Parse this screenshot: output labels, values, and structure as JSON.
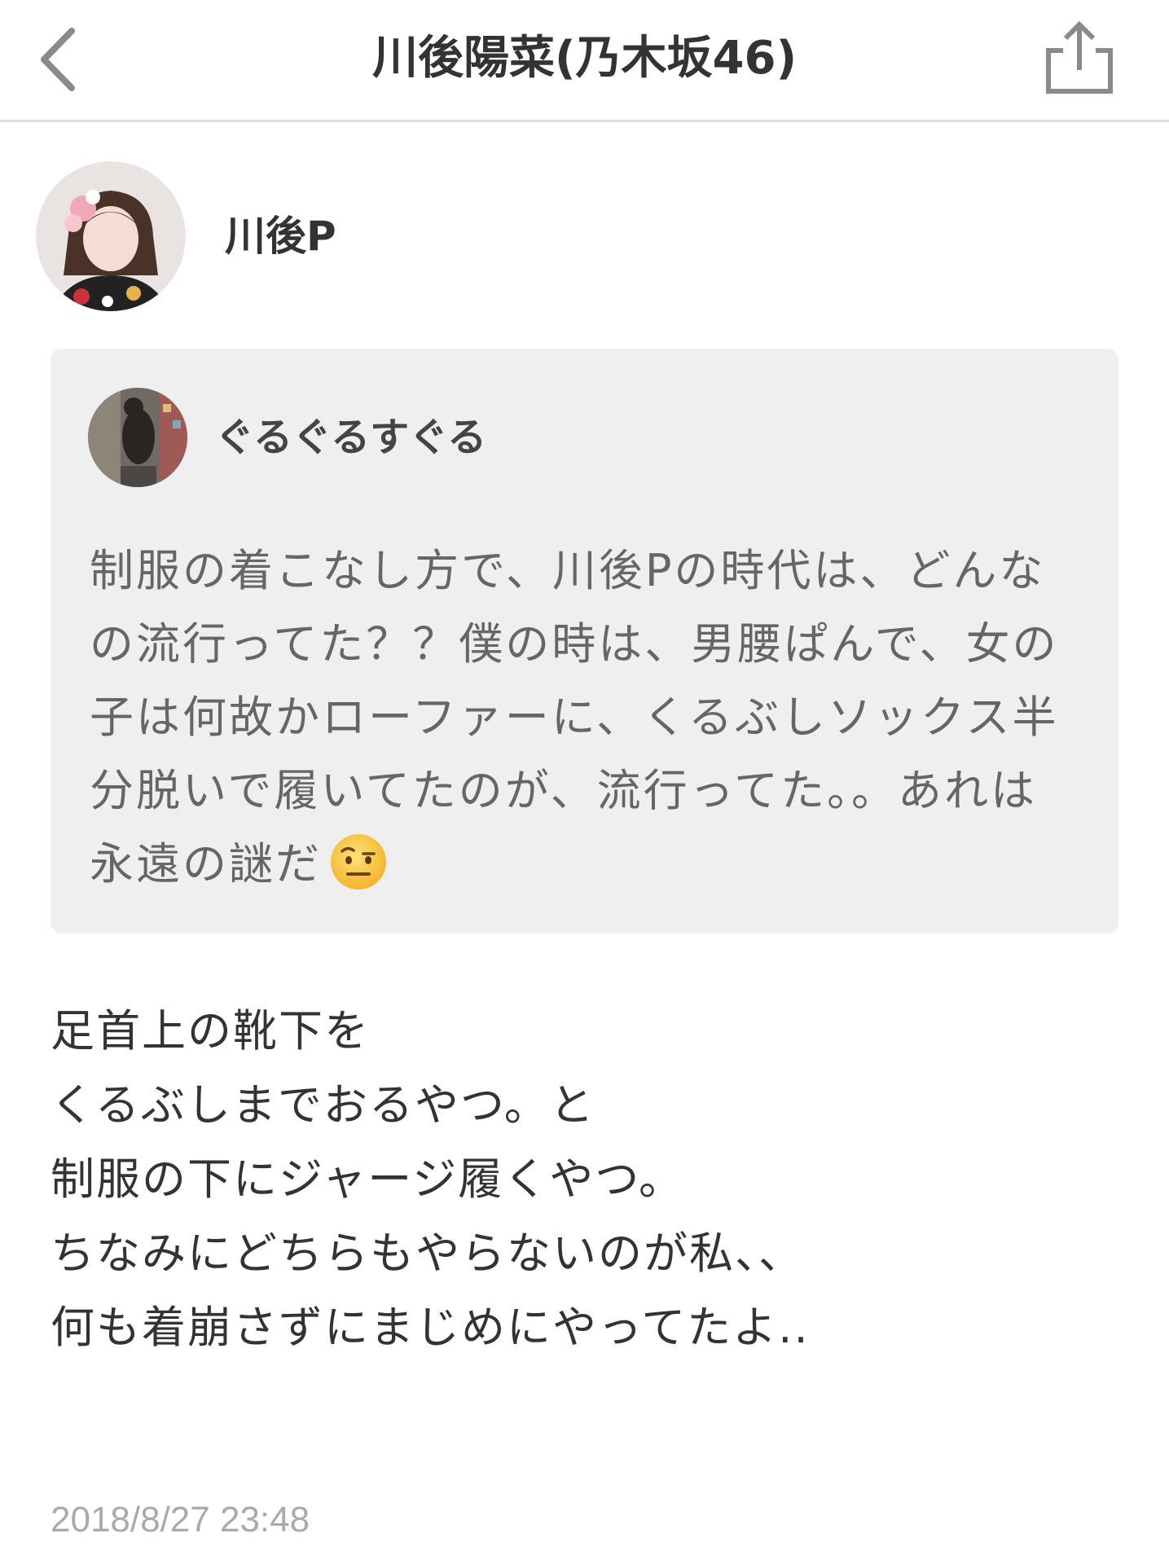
{
  "nav": {
    "title": "川後陽菜(乃木坂46)",
    "back_icon": "chevron-left-icon",
    "share_icon": "share-icon"
  },
  "author": {
    "name": "川後P"
  },
  "quote": {
    "name": "ぐるぐるすぐる",
    "lines": [
      "制服の着こなし方で、川後Pの時代は、どんな",
      "の流行ってた？？僕の時は、男腰ぱんで、女の",
      "子は何故かローファーに、くるぶしソックス半",
      "分脱いで履いてたのが、流行ってた。。あれは",
      "永遠の謎だ"
    ],
    "emoji": "raised-eyebrow-face-emoji"
  },
  "reply": {
    "lines": [
      "足首上の靴下を",
      "くるぶしまでおるやつ。と",
      "制服の下にジャージ履くやつ。",
      "ちなみにどちらもやらないのが私、、",
      "何も着崩さずにまじめにやってたよ.."
    ]
  },
  "timestamp": "2018/8/27 23:48",
  "colors": {
    "quote_bg": "#efefef",
    "divider": "#dedede",
    "timestamp": "#aaaaaa"
  }
}
